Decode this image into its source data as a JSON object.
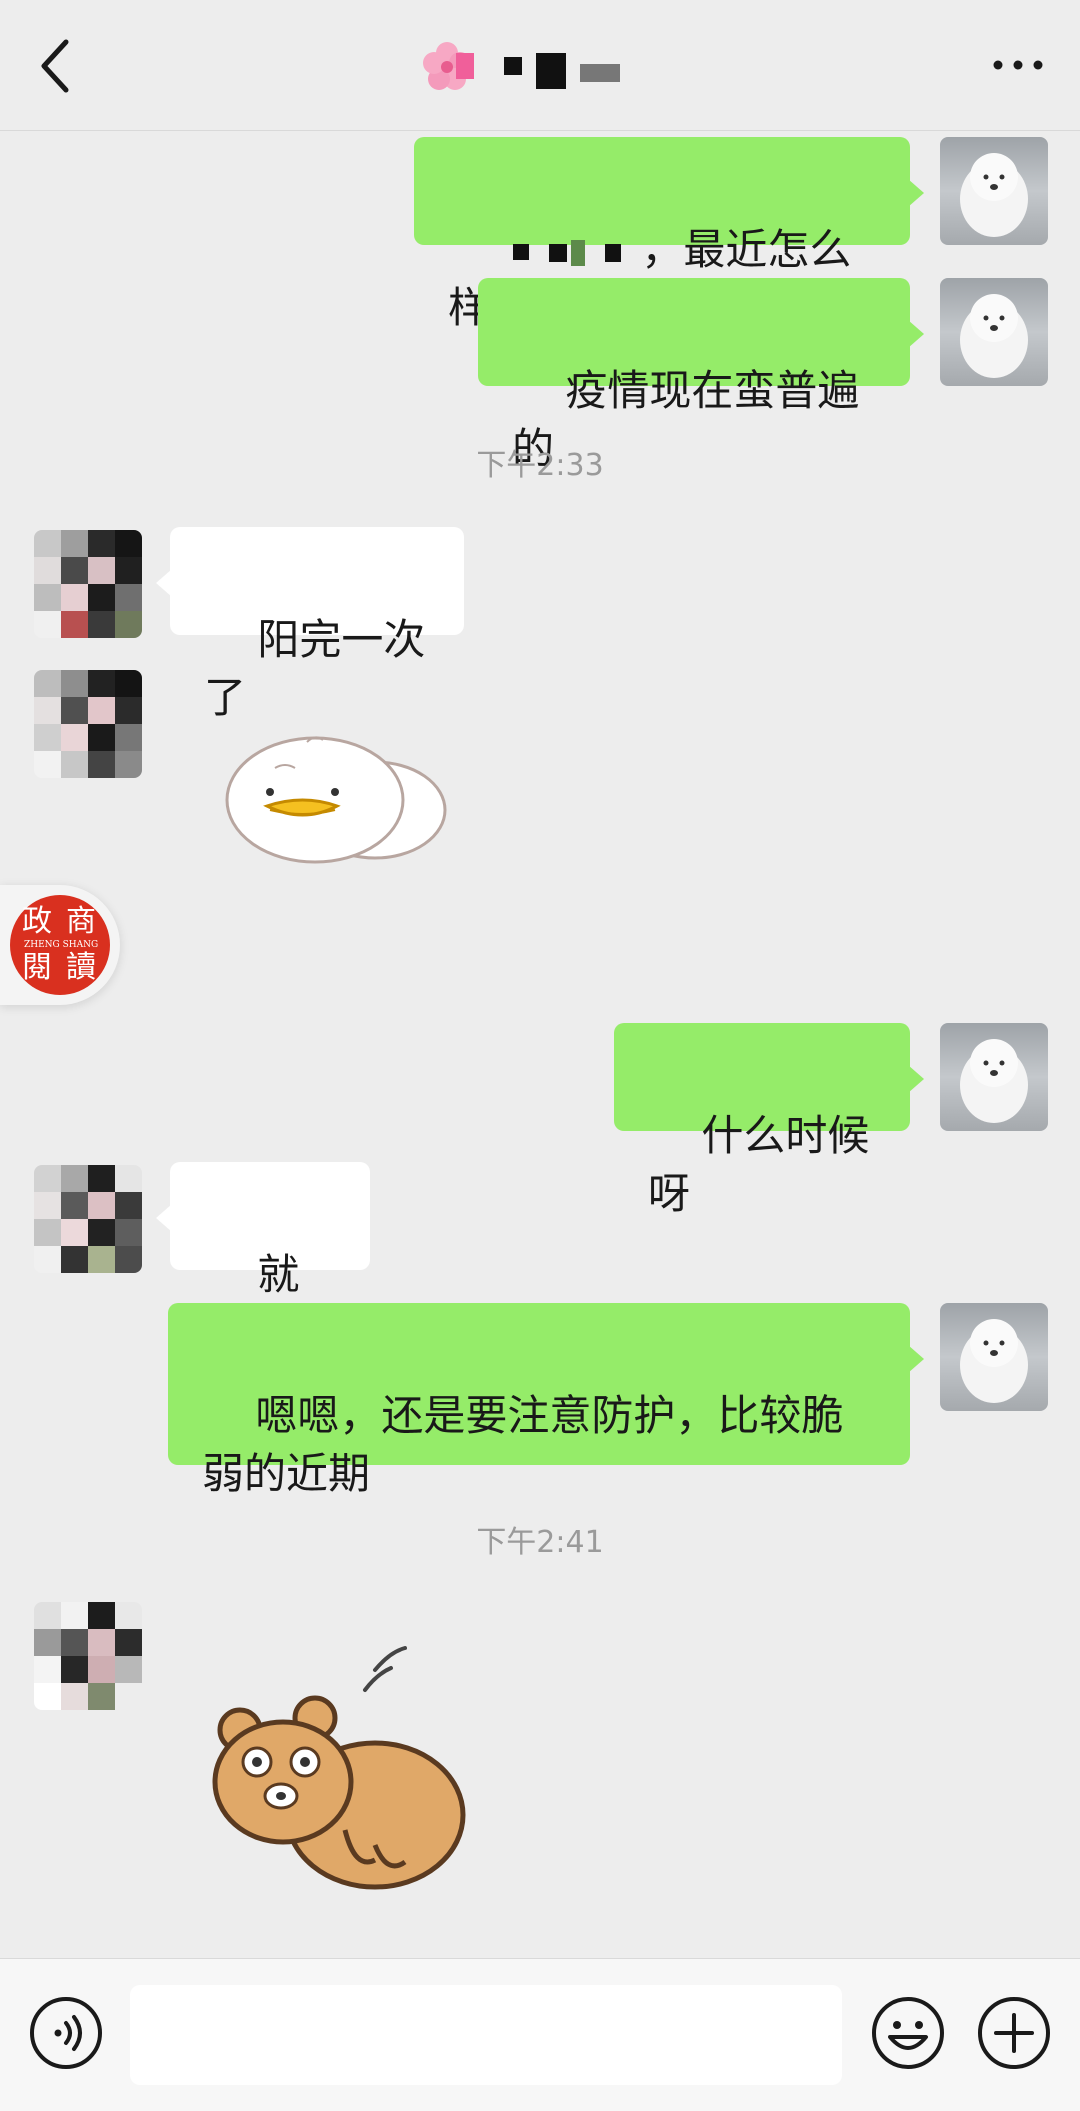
{
  "header": {
    "back_icon": "chevron-left-icon",
    "contact_name_redacted": true,
    "more_icon": "more-dots-icon"
  },
  "messages": [
    {
      "side": "right",
      "text": "，最近怎么样?"
    },
    {
      "side": "right",
      "text": "疫情现在蛮普遍的"
    },
    {
      "type": "timestamp",
      "text": "下午2:33"
    },
    {
      "side": "left",
      "text": "阳完一次了"
    },
    {
      "side": "left",
      "type": "sticker",
      "sticker": "duck-sticker"
    },
    {
      "side": "right",
      "text": "什么时候呀"
    },
    {
      "side": "left",
      "text": "就这周"
    },
    {
      "side": "right",
      "text": "嗯嗯，还是要注意防护，比较脆弱的近期"
    },
    {
      "type": "timestamp",
      "text": "下午2:41"
    },
    {
      "side": "left",
      "type": "sticker",
      "sticker": "bear-bow-sticker"
    }
  ],
  "watermark": {
    "chars": [
      "政",
      "商",
      "閱",
      "讀"
    ],
    "subtitle": "ZHENG SHANG"
  },
  "input_bar": {
    "voice_icon": "voice-icon",
    "placeholder": "",
    "emoji_icon": "emoji-icon",
    "add_icon": "plus-icon"
  },
  "colors": {
    "background": "#ededed",
    "outgoing_bubble": "#95ec69",
    "incoming_bubble": "#ffffff",
    "watermark": "#d9301f"
  }
}
